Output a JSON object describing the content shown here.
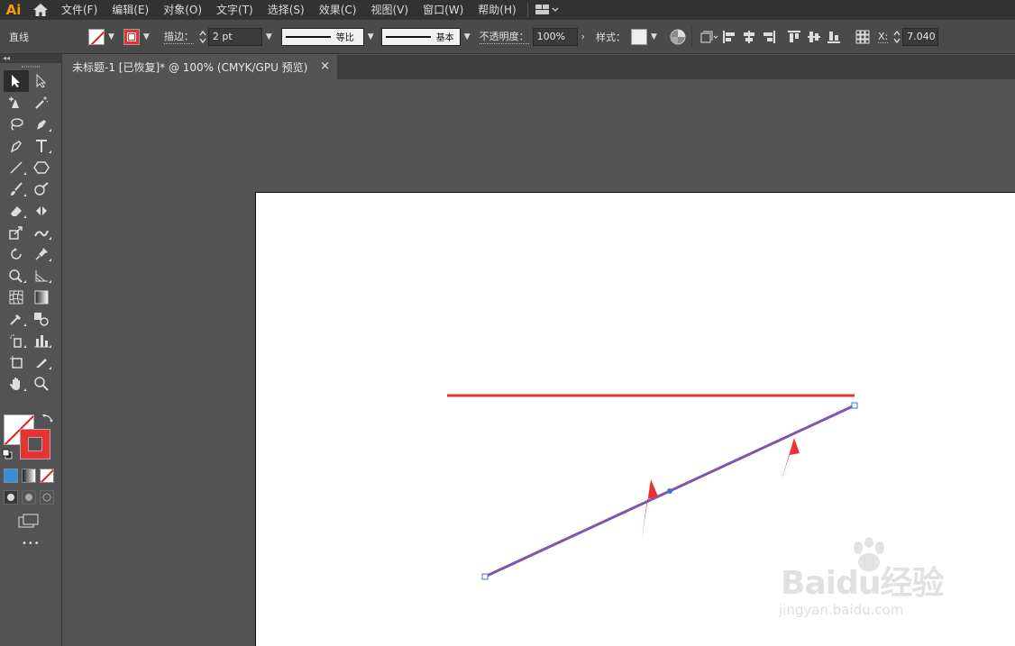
{
  "app": {
    "logo_text": "Ai",
    "accent_color": "#ff9a00"
  },
  "menu": {
    "items": [
      "文件(F)",
      "编辑(E)",
      "对象(O)",
      "文字(T)",
      "选择(S)",
      "效果(C)",
      "视图(V)",
      "窗口(W)",
      "帮助(H)"
    ]
  },
  "control_bar": {
    "object_type": "直线",
    "stroke_label": "描边：",
    "stroke_weight": "2 pt",
    "profile_label": "等比",
    "brush_label": "基本",
    "opacity_label": "不透明度：",
    "opacity_value": "100%",
    "style_label": "样式：",
    "x_label": "X:",
    "x_value": "7.040"
  },
  "document_tab": {
    "title": "未标题-1 [已恢复]* @ 100% (CMYK/GPU 预览)",
    "close_glyph": "×"
  },
  "toolbar": {
    "header_glyph": "◂◂",
    "more_glyph": "•••"
  },
  "colors": {
    "stroke_color": "#e83232",
    "selection_color": "#4a6cdc",
    "line_color": "#9a4a9a",
    "arrow_color": "#ef3030"
  },
  "watermark": {
    "brand": "Baidu经验",
    "url": "jingyan.baidu.com"
  }
}
